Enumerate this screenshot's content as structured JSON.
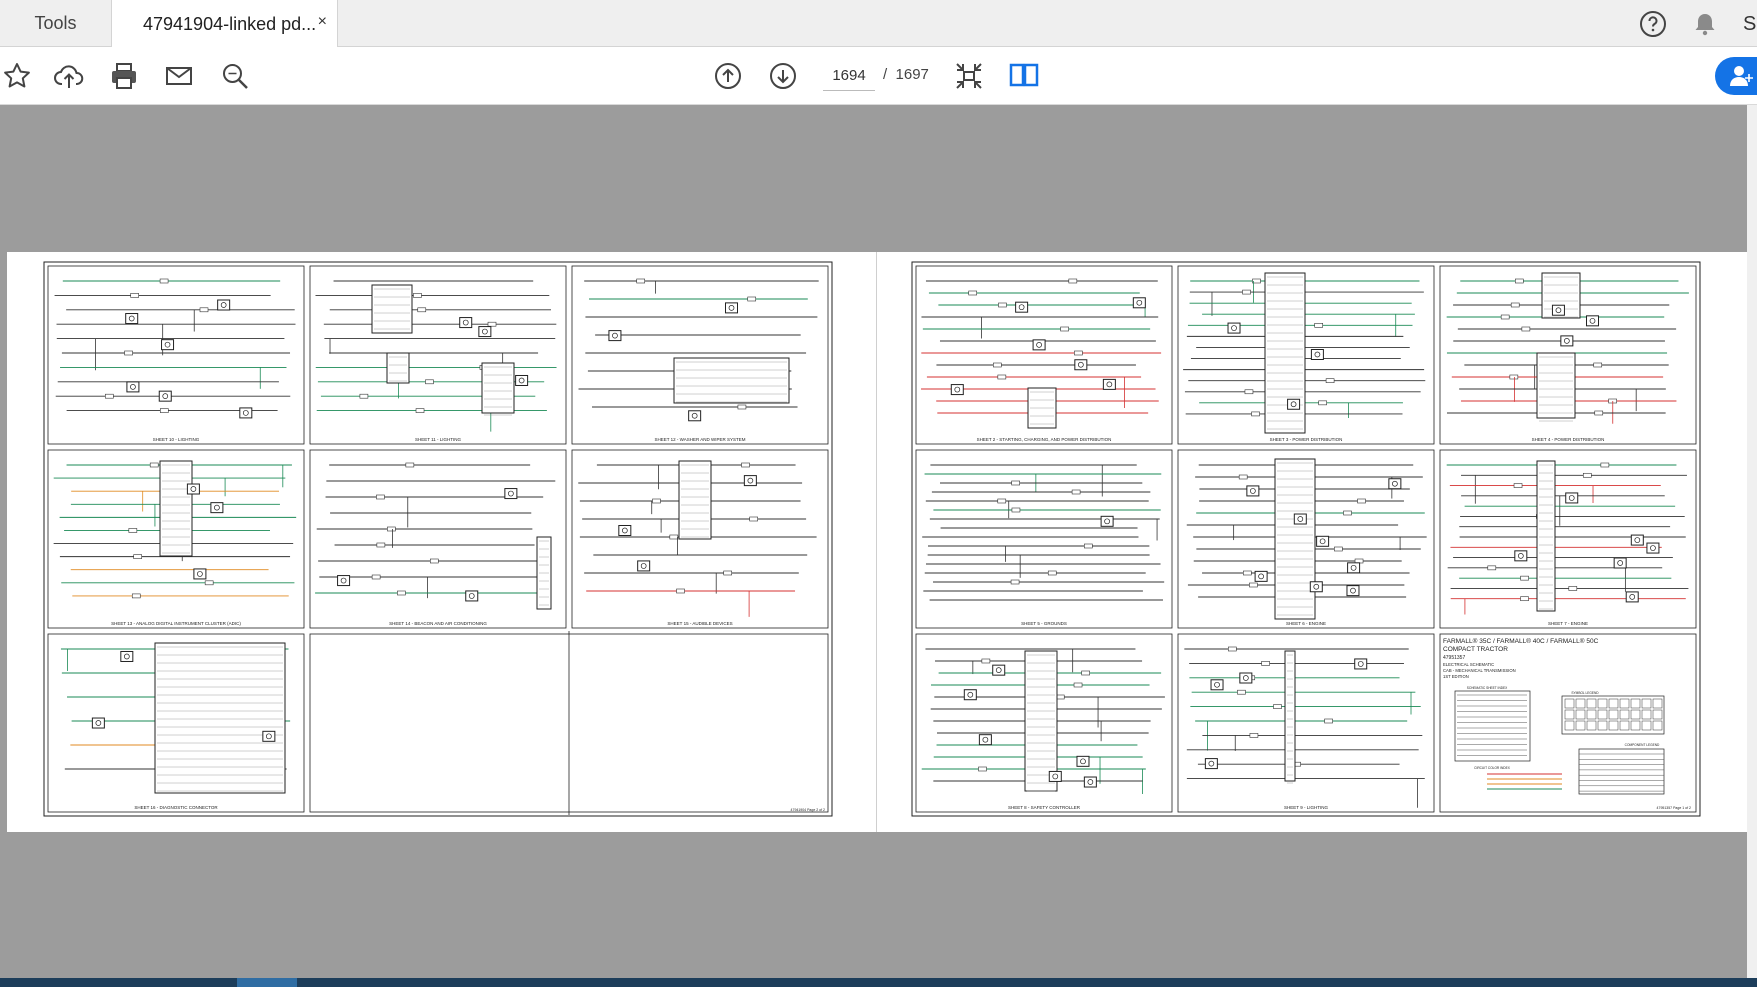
{
  "tabs": {
    "tools_label": "Tools",
    "doc_label": "47941904-linked pd...",
    "close_glyph": "×"
  },
  "header_icons": {
    "help": "help-icon",
    "notifications": "bell-icon",
    "user_initial": "S"
  },
  "toolbar": {
    "icons": [
      "star-icon",
      "upload-cloud-icon",
      "print-icon",
      "email-icon",
      "zoom-search-icon",
      "page-up-icon",
      "page-down-icon",
      "fit-page-icon",
      "two-page-view-icon",
      "share-user-icon"
    ],
    "current_page": "1694",
    "page_separator": "/",
    "total_pages": "1697"
  },
  "document": {
    "left_page": {
      "sheet_titles": [
        "SHEET 10 - LIGHTING",
        "SHEET 11 - LIGHTING",
        "SHEET 12 - WASHER AND WIPER SYSTEM",
        "SHEET 13 - ANALOG DIGITAL INSTRUMENT CLUSTER (ADIC)",
        "SHEET 14 - BEACON AND AIR CONDITIONING",
        "SHEET 15 - AUDIBLE DEVICES",
        "SHEET 16 - DIAGNOSTIC CONNECTOR"
      ],
      "footer": "47941904 Page 2 of 2"
    },
    "right_page": {
      "sheet_titles": [
        "SHEET 2 - STARTING, CHARGING, AND POWER DISTRIBUTION",
        "SHEET 3 - POWER DISTRIBUTION",
        "SHEET 4 - POWER DISTRIBUTION",
        "SHEET 5 - GROUNDS",
        "SHEET 6 - ENGINE",
        "SHEET 7 - ENGINE",
        "SHEET 8 - SAFETY CONTROLLER",
        "SHEET 9 - LIGHTING"
      ],
      "title_block": {
        "line1": "FARMALL® 35C / FARMALL® 40C / FARMALL® 50C",
        "line2": "COMPACT TRACTOR",
        "line3": "47951357",
        "line4": "ELECTRICAL SCHEMATIC",
        "line5": "CAB - MECHANICAL TRANSMISSION",
        "line6": "1ST EDITION"
      },
      "legend_titles": [
        "SCHEMATIC SHEET INDEX",
        "SYMBOL LEGEND",
        "COMPONENT LEGEND",
        "CIRCUIT COLOR INDEX"
      ],
      "footer": "47951357 Page 1 of 2"
    }
  },
  "colors": {
    "accent_blue": "#1473e6",
    "wire_green": "#1a8a55",
    "wire_red": "#d43030",
    "wire_orange": "#e08a20",
    "viewer_bg": "#9c9c9c"
  }
}
